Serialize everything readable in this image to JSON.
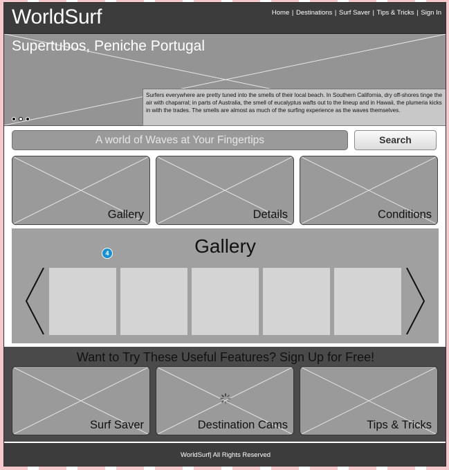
{
  "header": {
    "logo": "WorldSurf",
    "nav": [
      "Home",
      "Destinations",
      "Surf Saver",
      "Tips & Tricks",
      "Sign In"
    ]
  },
  "hero": {
    "title": "Supertubos, Peniche Portugal",
    "text": "Surfers everywhere are pretty tuned into the smells of their local beach. In Southern California, dry off-shores tinge the air with chaparral; in parts of Australia, the smell of eucalyptus wafts out to the lineup and in Hawaii, the plumeria kicks in with the trades. The smells are almost as much of the surfing experience as the waves themselves.",
    "slide_count": 3,
    "active_slide": 2
  },
  "search": {
    "placeholder": "A world of Waves at Your Fingertips",
    "button_label": "Search"
  },
  "tiles": [
    {
      "label": "Gallery"
    },
    {
      "label": "Details"
    },
    {
      "label": "Conditions"
    }
  ],
  "gallery": {
    "title": "Gallery",
    "badge": "4",
    "thumbnail_count": 5
  },
  "signup": {
    "title": "Want to Try These Useful Features? Sign Up for Free!",
    "features": [
      {
        "label": "Surf Saver"
      },
      {
        "label": "Destination Cams"
      },
      {
        "label": "Tips & Tricks"
      }
    ]
  },
  "footer": {
    "text": "WorldSurf| All Rights Reserved"
  },
  "colors": {
    "header_bg": "#3c3c3c",
    "placeholder_gray": "#949494",
    "badge_blue": "#1a8fcf"
  }
}
